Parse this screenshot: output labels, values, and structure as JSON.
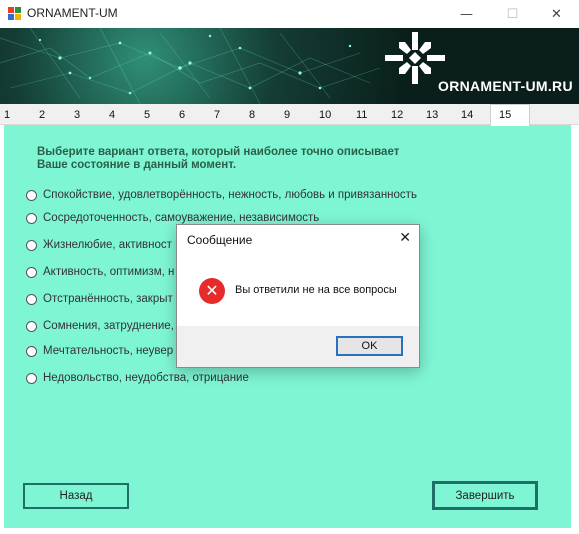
{
  "window": {
    "title": "ORNAMENT-UM",
    "controls": {
      "minimize": "—",
      "maximize": "☐",
      "close": "✕"
    }
  },
  "banner": {
    "brand": "ORNAMENT-UM.RU"
  },
  "tabs": [
    "1",
    "2",
    "3",
    "4",
    "5",
    "6",
    "7",
    "8",
    "9",
    "10",
    "11",
    "12",
    "13",
    "14",
    "15"
  ],
  "active_tab": "15",
  "question": "Выберите вариант ответа, который наиболее точно описывает\nВаше состояние в данный момент.",
  "options": [
    "Спокойствие, удовлетворённость, нежность, любовь и привязанность",
    "Сосредоточенность, самоуважение, независимость",
    "Жизнелюбие, активност",
    "Активность, оптимизм, н",
    "Отстранённость, закрыт",
    "Сомнения, затруднение,",
    "Мечтательность, неувер",
    "Недовольство, неудобства, отрицание"
  ],
  "buttons": {
    "back": "Назад",
    "finish": "Завершить"
  },
  "dialog": {
    "title": "Сообщение",
    "close": "✕",
    "icon": "✕",
    "message": "Вы ответили не на все вопросы",
    "ok": "OK"
  },
  "colors": {
    "panel": "#7ef6d4",
    "accent_border": "#1f6f66",
    "error": "#e52b2b",
    "focus": "#2b6fbf"
  }
}
